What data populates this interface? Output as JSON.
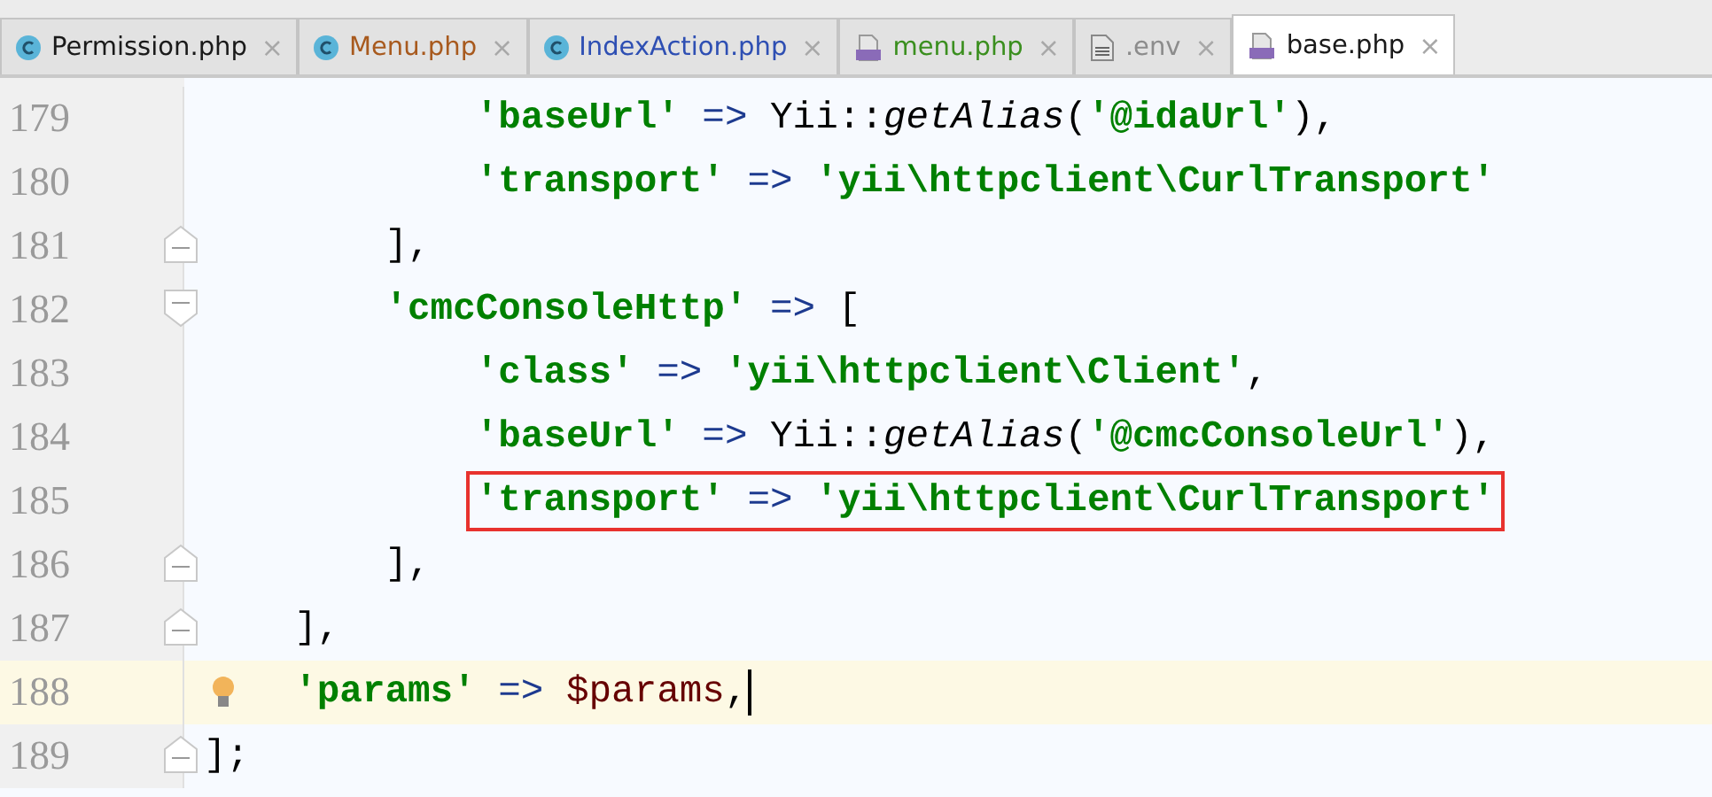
{
  "tabs": [
    {
      "label": "Permission.php",
      "kind": "class",
      "color": "#1a1a1a",
      "selected": false
    },
    {
      "label": "Menu.php",
      "kind": "class",
      "color": "#a85a1e",
      "selected": false
    },
    {
      "label": "IndexAction.php",
      "kind": "class",
      "color": "#2e4fb3",
      "selected": false
    },
    {
      "label": "menu.php",
      "kind": "php",
      "color": "#3b8f1f",
      "selected": false
    },
    {
      "label": ".env",
      "kind": "text",
      "color": "#8c8c8c",
      "selected": false
    },
    {
      "label": "base.php",
      "kind": "php",
      "color": "#1a1a1a",
      "selected": true
    }
  ],
  "close_glyph": "×",
  "lines": [
    {
      "number": "179",
      "tokens": [
        {
          "kind": "str",
          "text": "            'baseUrl'"
        },
        {
          "kind": "op",
          "text": " => "
        },
        {
          "kind": "plain",
          "text": "Yii::"
        },
        {
          "kind": "fn",
          "text": "getAlias"
        },
        {
          "kind": "plain",
          "text": "("
        },
        {
          "kind": "str",
          "text": "'@idaUrl'"
        },
        {
          "kind": "plain",
          "text": "),"
        }
      ]
    },
    {
      "number": "180",
      "tokens": [
        {
          "kind": "str",
          "text": "            'transport'"
        },
        {
          "kind": "op",
          "text": " => "
        },
        {
          "kind": "str",
          "text": "'yii\\httpclient\\CurlTransport'"
        }
      ]
    },
    {
      "number": "181",
      "fold_end": true,
      "tokens": [
        {
          "kind": "plain",
          "text": "        ],"
        }
      ]
    },
    {
      "number": "182",
      "fold_start": true,
      "tokens": [
        {
          "kind": "str",
          "text": "        'cmcConsoleHttp'"
        },
        {
          "kind": "op",
          "text": " => "
        },
        {
          "kind": "plain",
          "text": "["
        }
      ]
    },
    {
      "number": "183",
      "tokens": [
        {
          "kind": "str",
          "text": "            'class'"
        },
        {
          "kind": "op",
          "text": " => "
        },
        {
          "kind": "str",
          "text": "'yii\\httpclient\\Client'"
        },
        {
          "kind": "plain",
          "text": ","
        }
      ]
    },
    {
      "number": "184",
      "tokens": [
        {
          "kind": "str",
          "text": "            'baseUrl'"
        },
        {
          "kind": "op",
          "text": " => "
        },
        {
          "kind": "plain",
          "text": "Yii::"
        },
        {
          "kind": "fn",
          "text": "getAlias"
        },
        {
          "kind": "plain",
          "text": "("
        },
        {
          "kind": "str",
          "text": "'@cmcConsoleUrl'"
        },
        {
          "kind": "plain",
          "text": "),"
        }
      ]
    },
    {
      "number": "185",
      "boxed": true,
      "tokens": [
        {
          "kind": "str",
          "text": "            'transport'"
        },
        {
          "kind": "op",
          "text": " => "
        },
        {
          "kind": "str",
          "text": "'yii\\httpclient\\CurlTransport'"
        }
      ]
    },
    {
      "number": "186",
      "fold_end": true,
      "tokens": [
        {
          "kind": "plain",
          "text": "        ],"
        }
      ]
    },
    {
      "number": "187",
      "fold_end": true,
      "tokens": [
        {
          "kind": "plain",
          "text": "    ],"
        }
      ]
    },
    {
      "number": "188",
      "current": true,
      "bulb": true,
      "caret": true,
      "tokens": [
        {
          "kind": "str",
          "text": "    'params'"
        },
        {
          "kind": "op",
          "text": " => "
        },
        {
          "kind": "var",
          "text": "$params"
        },
        {
          "kind": "plain",
          "text": ","
        }
      ]
    },
    {
      "number": "189",
      "fold_end": true,
      "tokens": [
        {
          "kind": "plain",
          "text": "];"
        }
      ]
    }
  ]
}
